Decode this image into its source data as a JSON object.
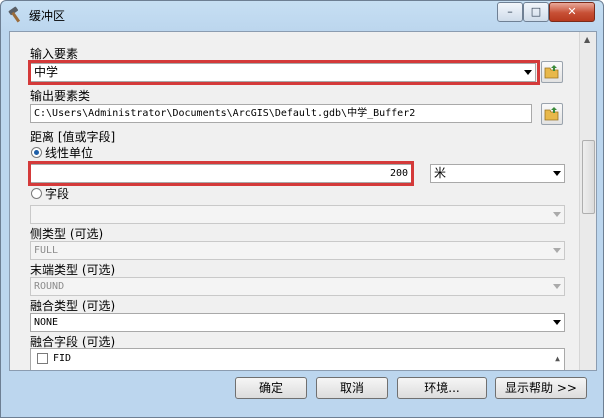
{
  "window": {
    "title": "缓冲区",
    "min_glyph": "–",
    "max_glyph": "□",
    "close_glyph": "✕"
  },
  "form": {
    "input_features": {
      "label": "输入要素",
      "value": "中学"
    },
    "output_features": {
      "label": "输出要素类",
      "value": "C:\\Users\\Administrator\\Documents\\ArcGIS\\Default.gdb\\中学_Buffer2"
    },
    "distance": {
      "label": "距离 [值或字段]",
      "linear_unit": {
        "label": "线性单位",
        "selected": true,
        "value": "200",
        "unit": "米"
      },
      "field": {
        "label": "字段",
        "selected": false,
        "value": ""
      }
    },
    "side_type": {
      "label": "侧类型 (可选)",
      "value": "FULL"
    },
    "end_type": {
      "label": "末端类型 (可选)",
      "value": "ROUND"
    },
    "dissolve_type": {
      "label": "融合类型 (可选)",
      "value": "NONE"
    },
    "dissolve_field": {
      "label": "融合字段 (可选)",
      "items": [
        "FID"
      ]
    }
  },
  "footer": {
    "ok": "确定",
    "cancel": "取消",
    "environments": "环境...",
    "show_help": "显示帮助 >>"
  },
  "colors": {
    "highlight": "#d43a3a",
    "title_bar": "#bcd6ee"
  }
}
